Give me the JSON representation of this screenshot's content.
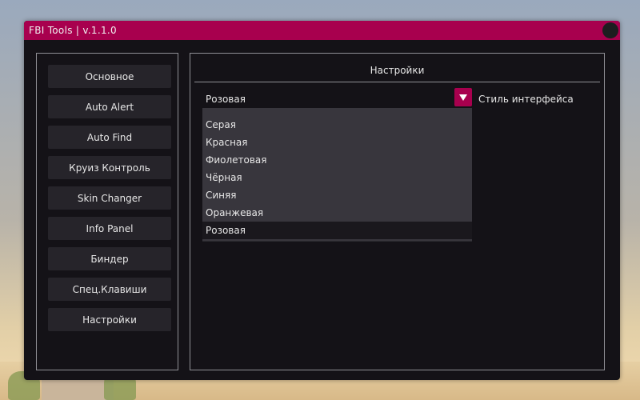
{
  "window": {
    "title": "FBI Tools | v.1.1.0"
  },
  "sidebar": {
    "items": [
      {
        "label": "Основное"
      },
      {
        "label": "Auto Alert"
      },
      {
        "label": "Auto Find"
      },
      {
        "label": "Круиз Контроль"
      },
      {
        "label": "Skin Changer"
      },
      {
        "label": "Info Panel"
      },
      {
        "label": "Биндер"
      },
      {
        "label": "Спец.Клавиши"
      },
      {
        "label": "Настройки"
      }
    ]
  },
  "main": {
    "title": "Настройки",
    "style_combo": {
      "value": "Розовая",
      "label": "Стиль интерфейса",
      "options": [
        "Серая",
        "Красная",
        "Фиолетовая",
        "Чёрная",
        "Синяя",
        "Оранжевая",
        "Розовая"
      ],
      "selected": "Розовая"
    }
  },
  "theme": {
    "accent": "#a8004e",
    "window_bg": "#141217",
    "button_bg": "#26242a",
    "dropdown_bg": "#38363d"
  }
}
